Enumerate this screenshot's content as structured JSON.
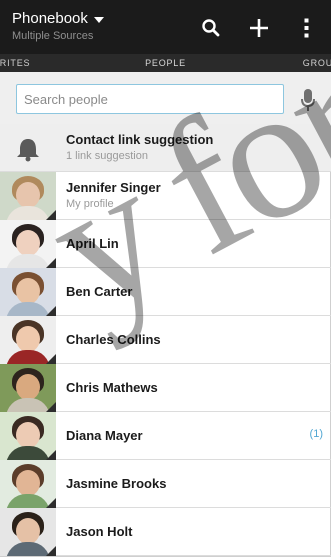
{
  "header": {
    "title": "Phonebook",
    "subtitle": "Multiple Sources"
  },
  "actions": {
    "search_icon": "search-icon",
    "add_icon": "plus-icon",
    "menu_icon": "more-vert-icon"
  },
  "tabs": [
    "ORITES",
    "PEOPLE",
    "GROU"
  ],
  "search": {
    "placeholder": "Search people"
  },
  "contacts": [
    {
      "name": "Contact link suggestion",
      "sub": "1 link suggestion",
      "type": "suggestion"
    },
    {
      "name": "Jennifer Singer",
      "sub": "My profile"
    },
    {
      "name": "April Lin"
    },
    {
      "name": "Ben Carter"
    },
    {
      "name": "Charles Collins"
    },
    {
      "name": "Chris Mathews"
    },
    {
      "name": "Diana Mayer",
      "badge": "(1)"
    },
    {
      "name": "Jasmine Brooks"
    },
    {
      "name": "Jason Holt"
    }
  ],
  "watermark": "y for",
  "colors": {
    "bar": "#1b1b1b",
    "accent": "#51a7d3"
  }
}
